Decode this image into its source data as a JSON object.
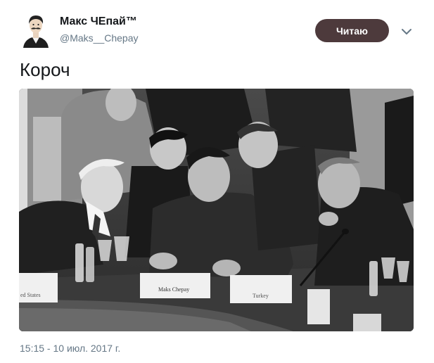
{
  "header": {
    "display_name": "Макс ЧЕпай™",
    "handle": "@Maks__Chepay",
    "follow_label": "Читаю",
    "follow_color": "#4d3a3c",
    "avatar_icon": "mustache-man-avatar",
    "menu_icon": "chevron-down-icon"
  },
  "tweet": {
    "text": "Короч",
    "timestamp": "15:15 - 10 июл. 2017 г."
  },
  "photo": {
    "placards": {
      "left": "ed States",
      "center": "Maks Chepay",
      "right": "Turkey"
    }
  }
}
